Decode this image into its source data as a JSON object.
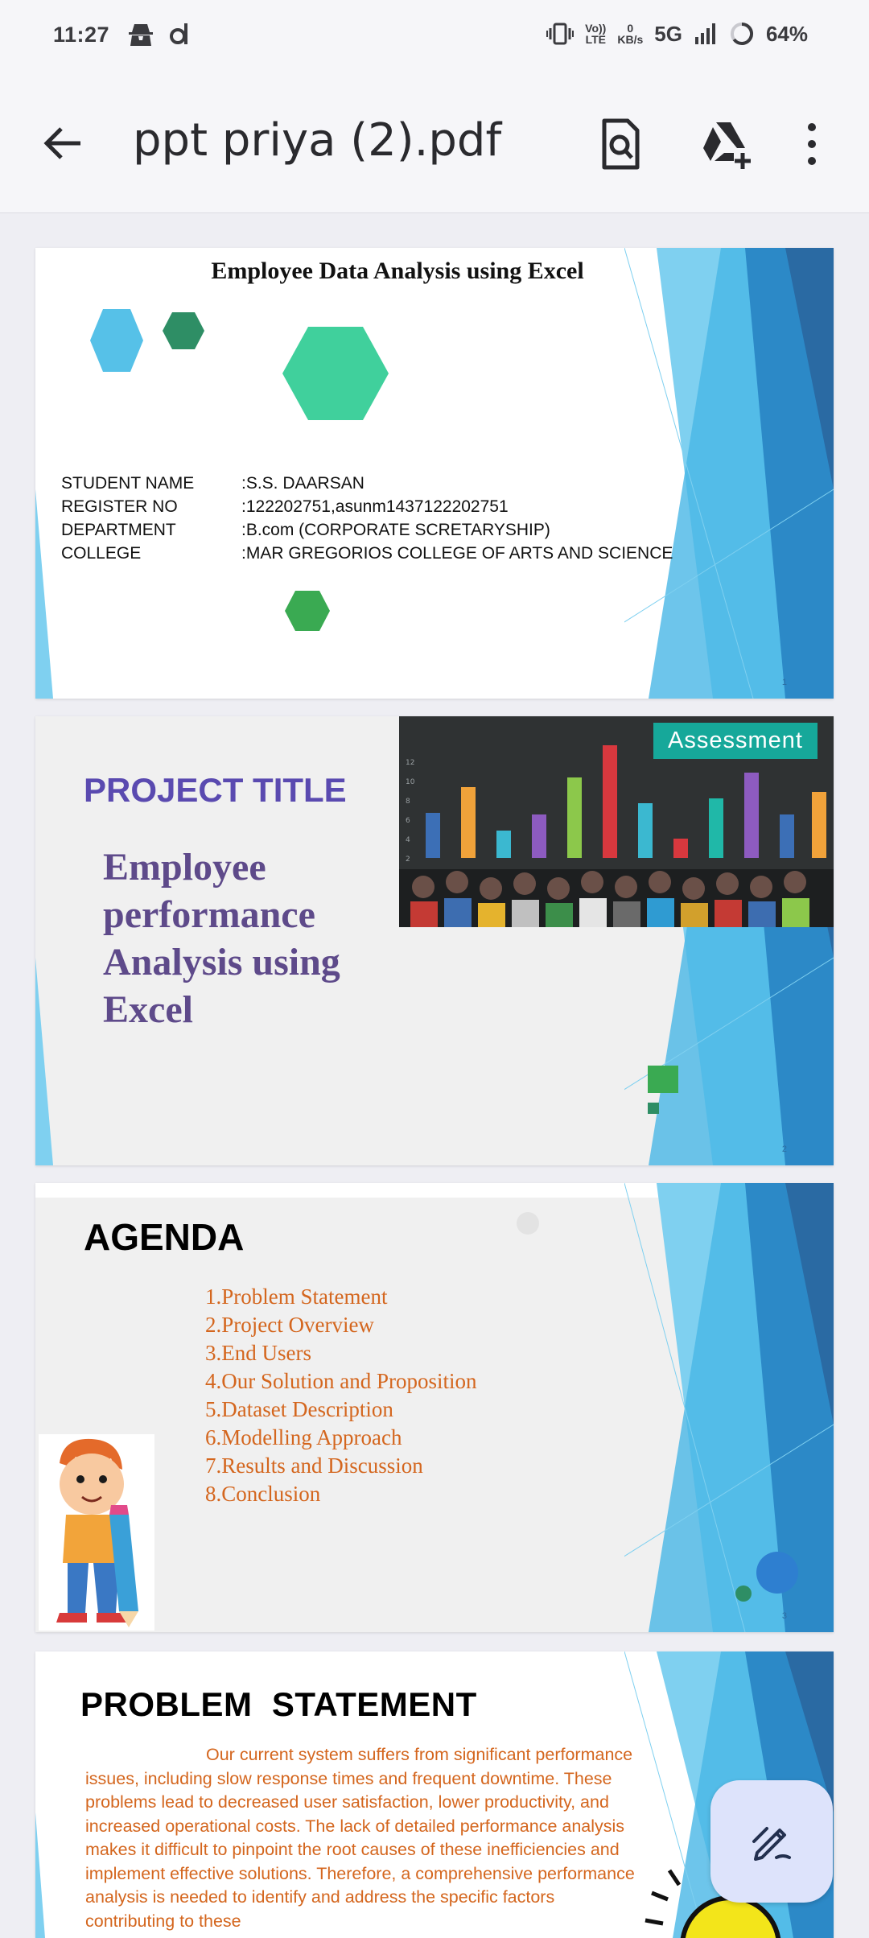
{
  "status_bar": {
    "time": "11:27",
    "volte_top": "Vo))",
    "volte_bottom": "LTE",
    "speed_value": "0",
    "speed_unit": "KB/s",
    "network": "5G",
    "battery": "64%"
  },
  "app_bar": {
    "title": "ppt priya (2).pdf"
  },
  "slides": [
    {
      "heading": "Employee Data Analysis using Excel",
      "rows": [
        {
          "label": "STUDENT NAME",
          "value": ":S.S. DAARSAN"
        },
        {
          "label": "REGISTER NO",
          "value": ":122202751,asunm1437122202751"
        },
        {
          "label": "DEPARTMENT",
          "value": ":B.com (CORPORATE SCRETARYSHIP)"
        },
        {
          "label": "COLLEGE",
          "value": ":MAR GREGORIOS COLLEGE OF ARTS AND SCIENCE"
        }
      ],
      "page": "1"
    },
    {
      "title": "PROJECT TITLE",
      "text": "Employee performance Analysis using Excel",
      "photo_label": "Assessment",
      "page": "2"
    },
    {
      "title": "AGENDA",
      "items": [
        "1.Problem Statement",
        "2.Project Overview",
        "3.End Users",
        "4.Our Solution and Proposition",
        "5.Dataset Description",
        "6.Modelling Approach",
        "7.Results and Discussion",
        "8.Conclusion"
      ],
      "page": "3"
    },
    {
      "title": "PROBLEM  STATEMENT",
      "paragraph": "Our current system suffers from significant performance issues, including slow response times and frequent downtime. These problems lead to decreased user satisfaction, lower productivity, and increased operational costs. The lack of detailed performance analysis makes it difficult to pinpoint the root causes of these inefficiencies and implement effective solutions. Therefore, a comprehensive performance analysis is needed to identify and address the specific factors contributing to these"
    }
  ],
  "colors": {
    "accent_blue": "#2e8ad0",
    "heading_purple": "#5a4ab0",
    "agenda_orange": "#d4661e",
    "fab_bg": "#dde3fb"
  },
  "icons": [
    "back-arrow-icon",
    "search-document-icon",
    "drive-add-icon",
    "more-vert-icon",
    "edit-pen-icon"
  ]
}
